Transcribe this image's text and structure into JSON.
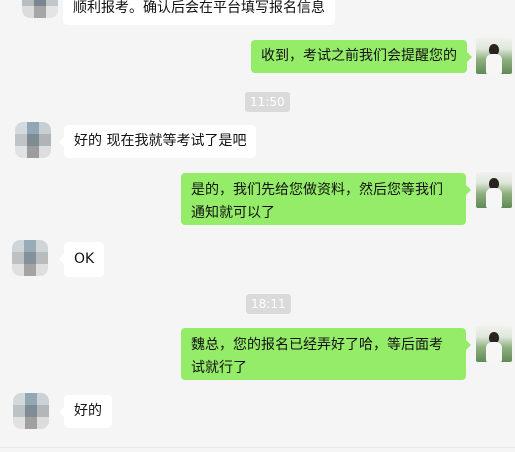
{
  "messages": [
    {
      "text": "顺利报考。确认后会在平台填写报名信息"
    },
    {
      "text": "收到，考试之前我们会提醒您的"
    },
    {
      "text": "好的  现在我就等考试了是吧"
    },
    {
      "text": "是的，我们先给您做资料，然后您等我们通知就可以了"
    },
    {
      "text": "OK"
    },
    {
      "text": "魏总，您的报名已经弄好了哈，等后面考试就行了"
    },
    {
      "text": "好的"
    }
  ],
  "timestamps": [
    "11:50",
    "18:11"
  ],
  "colors": {
    "background": "#f5f5f5",
    "incoming_bubble": "#ffffff",
    "outgoing_bubble": "#95ec69",
    "timestamp_bg": "#dadada"
  }
}
